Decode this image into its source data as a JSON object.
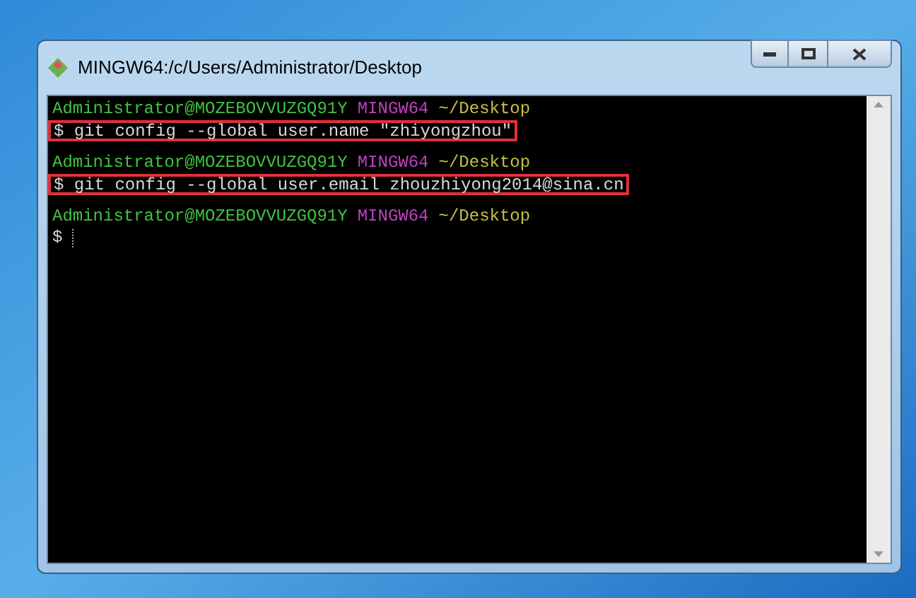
{
  "window": {
    "title": "MINGW64:/c/Users/Administrator/Desktop"
  },
  "lines": [
    {
      "kind": "prompt",
      "user_host": "Administrator@MOZEBOVVUZGQ91Y",
      "system": "MINGW64",
      "path": "~/Desktop"
    },
    {
      "kind": "command",
      "text": "$ git config --global user.name \"zhiyongzhou\"",
      "highlighted": true
    },
    {
      "kind": "blank"
    },
    {
      "kind": "prompt",
      "user_host": "Administrator@MOZEBOVVUZGQ91Y",
      "system": "MINGW64",
      "path": "~/Desktop"
    },
    {
      "kind": "command",
      "text": "$ git config --global user.email zhouzhiyong2014@sina.cn",
      "highlighted": true
    },
    {
      "kind": "blank"
    },
    {
      "kind": "prompt",
      "user_host": "Administrator@MOZEBOVVUZGQ91Y",
      "system": "MINGW64",
      "path": "~/Desktop"
    },
    {
      "kind": "cursor",
      "text": "$"
    }
  ]
}
